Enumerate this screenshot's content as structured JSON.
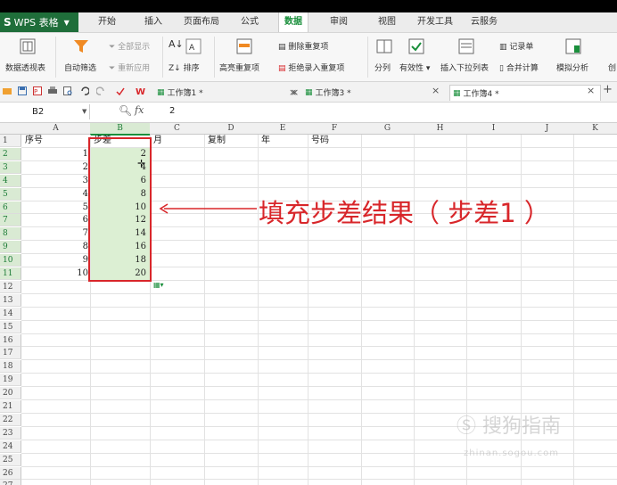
{
  "app": {
    "name": "WPS 表格"
  },
  "menu": {
    "items": [
      "开始",
      "插入",
      "页面布局",
      "公式",
      "数据",
      "审阅",
      "视图",
      "开发工具",
      "云服务"
    ],
    "active": "数据"
  },
  "ribbon": {
    "pivot": "数据透视表",
    "autofilter": "自动筛选",
    "show_all": "全部显示",
    "reapply": "重新应用",
    "sort": "排序",
    "highlight_dup": "高亮重复项",
    "remove_dup": "删除重复项",
    "reject_dup": "拒绝录入重复项",
    "split": "分列",
    "validity": "有效性",
    "dropdown": "插入下拉列表",
    "record": "记录单",
    "consolidate": "合并计算",
    "simulate": "模拟分析",
    "create": "创"
  },
  "tabs": [
    {
      "label": "工作簿1 *"
    },
    {
      "label": "工作簿3 *"
    },
    {
      "label": "工作簿4 *"
    }
  ],
  "formula": {
    "namebox": "B2",
    "fx": "fx",
    "value": "2"
  },
  "columns": [
    "A",
    "B",
    "C",
    "D",
    "E",
    "F",
    "G",
    "H",
    "I",
    "J",
    "K"
  ],
  "rows": [
    "1",
    "2",
    "3",
    "4",
    "5",
    "6",
    "7",
    "8",
    "9",
    "10",
    "11",
    "12",
    "13",
    "14",
    "15",
    "16",
    "17",
    "18",
    "19",
    "20",
    "21",
    "22",
    "23",
    "24",
    "25",
    "26",
    "27"
  ],
  "headers": {
    "A": "序号",
    "B": "步差",
    "C": "月",
    "D": "复制",
    "E": "年",
    "F": "号码"
  },
  "colA": [
    "1",
    "2",
    "3",
    "4",
    "5",
    "6",
    "7",
    "8",
    "9",
    "10"
  ],
  "colB": [
    "2",
    "4",
    "6",
    "8",
    "10",
    "12",
    "14",
    "16",
    "18",
    "20"
  ],
  "annotation": "填充步差结果（ 步差1 ）",
  "watermark": {
    "text": "搜狗指南",
    "sub": "zhinan.sogou.com"
  },
  "colors": {
    "accent": "#1a8f3c",
    "annotation": "#d8262a",
    "selection": "#dcefd3"
  }
}
